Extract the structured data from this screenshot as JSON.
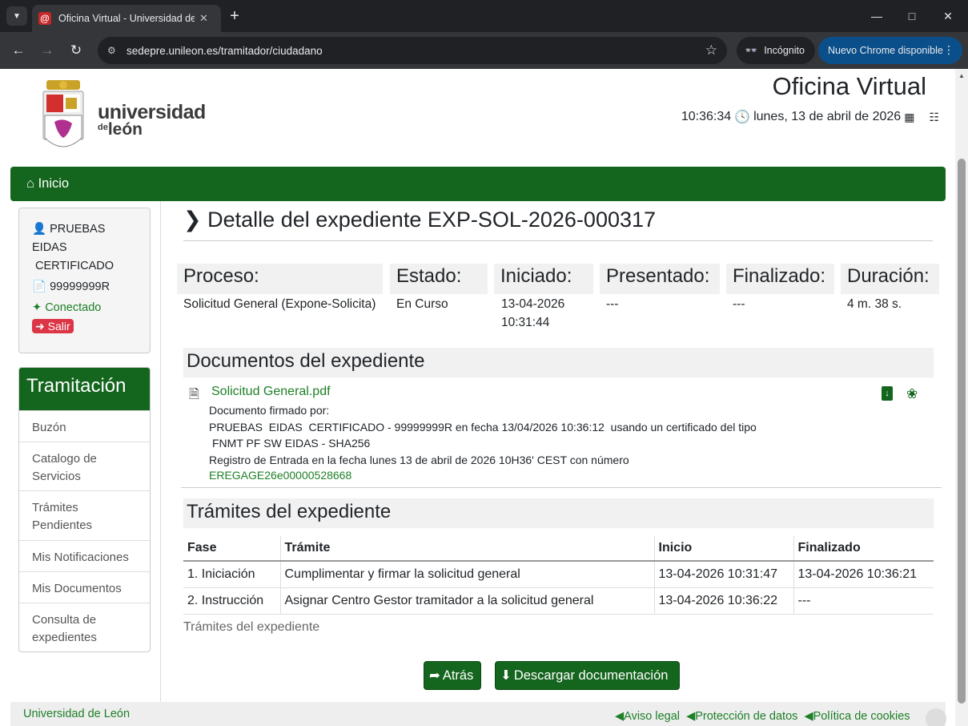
{
  "browser": {
    "tab_title": "Oficina Virtual - Universidad de",
    "url": "sedepre.unileon.es/tramitador/ciudadano",
    "incognito_label": "Incógnito",
    "update_label": "Nuevo Chrome disponible"
  },
  "header": {
    "logo_line1": "universidad",
    "logo_de": "de",
    "logo_line2": "león",
    "title": "Oficina Virtual",
    "time": "10:36:34",
    "date": "lunes, 13 de abril de 2026"
  },
  "navbar": {
    "home_label": "Inicio"
  },
  "user": {
    "name1": "PRUEBAS",
    "name2": "EIDAS",
    "name3": "CERTIFICADO",
    "id": "99999999R",
    "status": "Conectado",
    "logout": "Salir"
  },
  "sidebar": {
    "title": "Tramitación",
    "items": [
      "Buzón",
      "Catalogo de Servicios",
      "Trámites Pendientes",
      "Mis Notificaciones",
      "Mis Documentos",
      "Consulta de expedientes"
    ]
  },
  "detail": {
    "heading": "Detalle del expediente EXP-SOL-2026-000317",
    "summary": [
      {
        "label": "Proceso:",
        "value": "Solicitud General (Expone-Solicita)"
      },
      {
        "label": "Estado:",
        "value": "En Curso"
      },
      {
        "label": "Iniciado:",
        "value": "13-04-2026 10:31:44"
      },
      {
        "label": "Presentado:",
        "value": "---"
      },
      {
        "label": "Finalizado:",
        "value": "---"
      },
      {
        "label": "Duración:",
        "value": "4 m. 38 s."
      }
    ]
  },
  "documents": {
    "heading": "Documentos del expediente",
    "file": "Solicitud General.pdf",
    "signed_by": "Documento firmado por:",
    "signer_line": "PRUEBAS  EIDAS  CERTIFICADO - 99999999R en fecha 13/04/2026 10:36:12  usando un certificado del tipo",
    "cert_type": "FNMT PF SW EIDAS - SHA256",
    "registry_line": "Registro de Entrada en la fecha lunes 13 de abril de 2026 10H36' CEST con número",
    "registry_number": "EREGAGE26e00000528668"
  },
  "tramites": {
    "heading": "Trámites del expediente",
    "columns": [
      "Fase",
      "Trámite",
      "Inicio",
      "Finalizado"
    ],
    "rows": [
      [
        "1. Iniciación",
        "Cumplimentar y firmar la solicitud general",
        "13-04-2026 10:31:47",
        "13-04-2026 10:36:21"
      ],
      [
        "2. Instrucción",
        "Asignar Centro Gestor tramitador a la solicitud general",
        "13-04-2026 10:36:22",
        "---"
      ]
    ],
    "caption": "Trámites del expediente"
  },
  "actions": {
    "back": "Atrás",
    "download": "Descargar documentación"
  },
  "footer": {
    "org": "Universidad de León",
    "links": [
      "Aviso legal",
      "Protección de datos",
      "Política de cookies"
    ]
  }
}
